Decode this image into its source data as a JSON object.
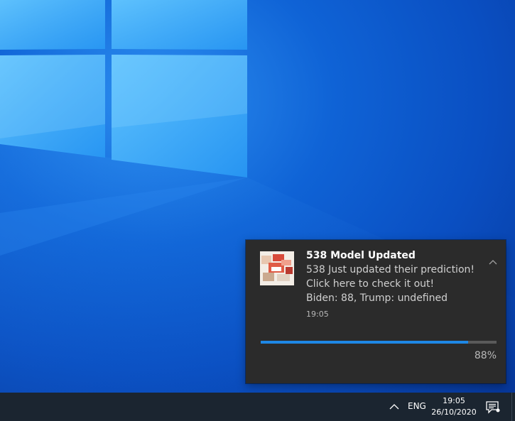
{
  "desktop": {
    "wallpaper": "windows-10-light-logo",
    "colors": {
      "accent": "#1e88e5"
    }
  },
  "notification": {
    "logo_icon": "538-app-logo",
    "title": "538 Model Updated",
    "body_lines": [
      "538 Just updated their prediction!",
      "Click here to check it out!",
      "Biden: 88, Trump: undefined"
    ],
    "time": "19:05",
    "collapse_icon": "chevron-up-icon",
    "progress": {
      "value": 0.88,
      "label": "88%"
    }
  },
  "taskbar": {
    "tray": {
      "chevron_icon": "chevron-up-icon",
      "language": "ENG",
      "time": "19:05",
      "date": "26/10/2020",
      "action_center_icon": "action-center-icon"
    }
  }
}
